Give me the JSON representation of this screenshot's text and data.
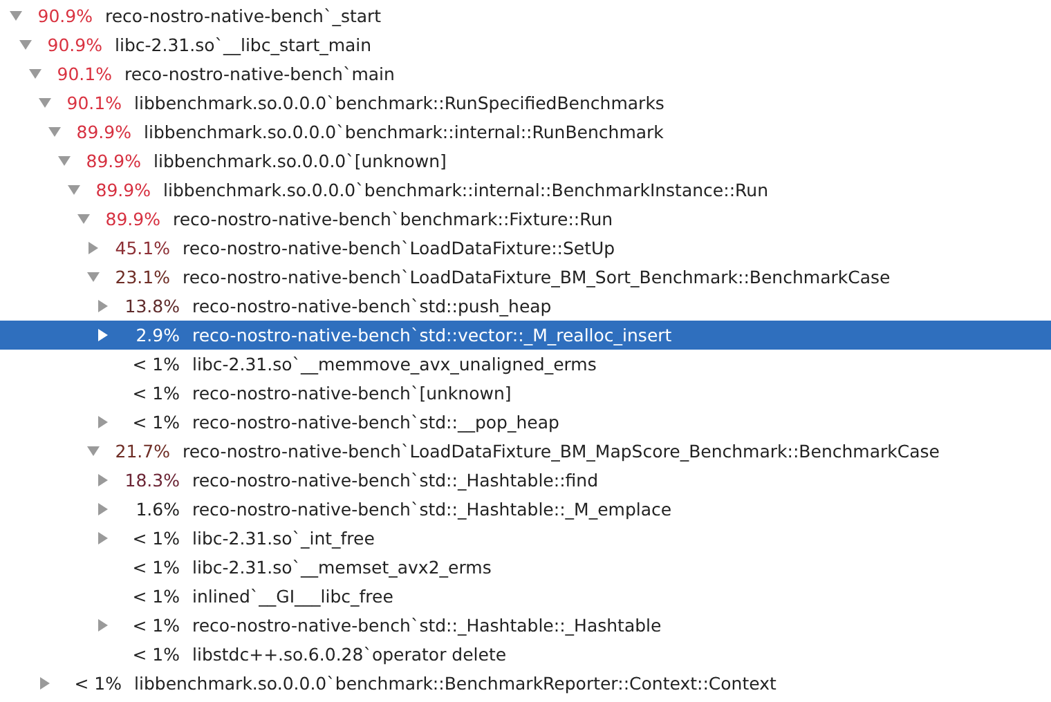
{
  "tree": [
    {
      "percent": "90.9%",
      "color": "#d93240",
      "name": "reco-nostro-native-bench`_start",
      "kind": "branch",
      "expanded": true,
      "selected": false,
      "children": [
        {
          "percent": "90.9%",
          "color": "#d93240",
          "name": "libc-2.31.so`__libc_start_main",
          "kind": "branch",
          "expanded": true,
          "selected": false,
          "children": [
            {
              "percent": "90.1%",
              "color": "#d93240",
              "name": "reco-nostro-native-bench`main",
              "kind": "branch",
              "expanded": true,
              "selected": false,
              "children": [
                {
                  "percent": "90.1%",
                  "color": "#d93240",
                  "name": "libbenchmark.so.0.0.0`benchmark::RunSpecifiedBenchmarks",
                  "kind": "branch",
                  "expanded": true,
                  "selected": false,
                  "children": [
                    {
                      "percent": "89.9%",
                      "color": "#d63040",
                      "name": "libbenchmark.so.0.0.0`benchmark::internal::RunBenchmark",
                      "kind": "branch",
                      "expanded": true,
                      "selected": false,
                      "children": [
                        {
                          "percent": "89.9%",
                          "color": "#d63040",
                          "name": "libbenchmark.so.0.0.0`[unknown]",
                          "kind": "branch",
                          "expanded": true,
                          "selected": false,
                          "children": [
                            {
                              "percent": "89.9%",
                              "color": "#d63040",
                              "name": "libbenchmark.so.0.0.0`benchmark::internal::BenchmarkInstance::Run",
                              "kind": "branch",
                              "expanded": true,
                              "selected": false,
                              "children": [
                                {
                                  "percent": "89.9%",
                                  "color": "#d63040",
                                  "name": "reco-nostro-native-bench`benchmark::Fixture::Run",
                                  "kind": "branch",
                                  "expanded": true,
                                  "selected": false,
                                  "children": [
                                    {
                                      "percent": "45.1%",
                                      "color": "#8c2f35",
                                      "name": "reco-nostro-native-bench`LoadDataFixture::SetUp",
                                      "kind": "branch",
                                      "expanded": false,
                                      "selected": false
                                    },
                                    {
                                      "percent": "23.1%",
                                      "color": "#6e2d25",
                                      "name": "reco-nostro-native-bench`LoadDataFixture_BM_Sort_Benchmark::BenchmarkCase",
                                      "kind": "branch",
                                      "expanded": true,
                                      "selected": false,
                                      "children": [
                                        {
                                          "percent": "13.8%",
                                          "color": "#5e2a2a",
                                          "name": "reco-nostro-native-bench`std::push_heap",
                                          "kind": "branch",
                                          "expanded": false,
                                          "selected": false
                                        },
                                        {
                                          "percent": "2.9%",
                                          "name": "reco-nostro-native-bench`std::vector::_M_realloc_insert",
                                          "kind": "branch",
                                          "expanded": false,
                                          "selected": true
                                        },
                                        {
                                          "percent": "< 1%",
                                          "color": "#222222",
                                          "name": "libc-2.31.so`__memmove_avx_unaligned_erms",
                                          "kind": "leaf",
                                          "selected": false
                                        },
                                        {
                                          "percent": "< 1%",
                                          "color": "#222222",
                                          "name": "reco-nostro-native-bench`[unknown]",
                                          "kind": "leaf",
                                          "selected": false
                                        },
                                        {
                                          "percent": "< 1%",
                                          "color": "#222222",
                                          "name": "reco-nostro-native-bench`std::__pop_heap",
                                          "kind": "branch",
                                          "expanded": false,
                                          "selected": false
                                        }
                                      ]
                                    },
                                    {
                                      "percent": "21.7%",
                                      "color": "#6e2d25",
                                      "name": "reco-nostro-native-bench`LoadDataFixture_BM_MapScore_Benchmark::BenchmarkCase",
                                      "kind": "branch",
                                      "expanded": true,
                                      "selected": false,
                                      "children": [
                                        {
                                          "percent": "18.3%",
                                          "color": "#6b2535",
                                          "name": "reco-nostro-native-bench`std::_Hashtable::find",
                                          "kind": "branch",
                                          "expanded": false,
                                          "selected": false
                                        },
                                        {
                                          "percent": "1.6%",
                                          "color": "#222222",
                                          "name": "reco-nostro-native-bench`std::_Hashtable::_M_emplace",
                                          "kind": "branch",
                                          "expanded": false,
                                          "selected": false
                                        },
                                        {
                                          "percent": "< 1%",
                                          "color": "#222222",
                                          "name": "libc-2.31.so`_int_free",
                                          "kind": "branch",
                                          "expanded": false,
                                          "selected": false
                                        },
                                        {
                                          "percent": "< 1%",
                                          "color": "#222222",
                                          "name": "libc-2.31.so`__memset_avx2_erms",
                                          "kind": "leaf",
                                          "selected": false
                                        },
                                        {
                                          "percent": "< 1%",
                                          "color": "#222222",
                                          "name": "inlined`__GI___libc_free",
                                          "kind": "leaf",
                                          "selected": false
                                        },
                                        {
                                          "percent": "< 1%",
                                          "color": "#222222",
                                          "name": "reco-nostro-native-bench`std::_Hashtable::_Hashtable",
                                          "kind": "branch",
                                          "expanded": false,
                                          "selected": false
                                        },
                                        {
                                          "percent": "< 1%",
                                          "color": "#222222",
                                          "name": "libstdc++.so.6.0.28`operator delete",
                                          "kind": "leaf",
                                          "selected": false
                                        }
                                      ]
                                    }
                                  ]
                                }
                              ]
                            }
                          ]
                        }
                      ]
                    }
                  ]
                },
                {
                  "percent": "< 1%",
                  "color": "#222222",
                  "name": "libbenchmark.so.0.0.0`benchmark::BenchmarkReporter::Context::Context",
                  "kind": "branch",
                  "expanded": false,
                  "selected": false
                }
              ]
            }
          ]
        }
      ]
    }
  ]
}
